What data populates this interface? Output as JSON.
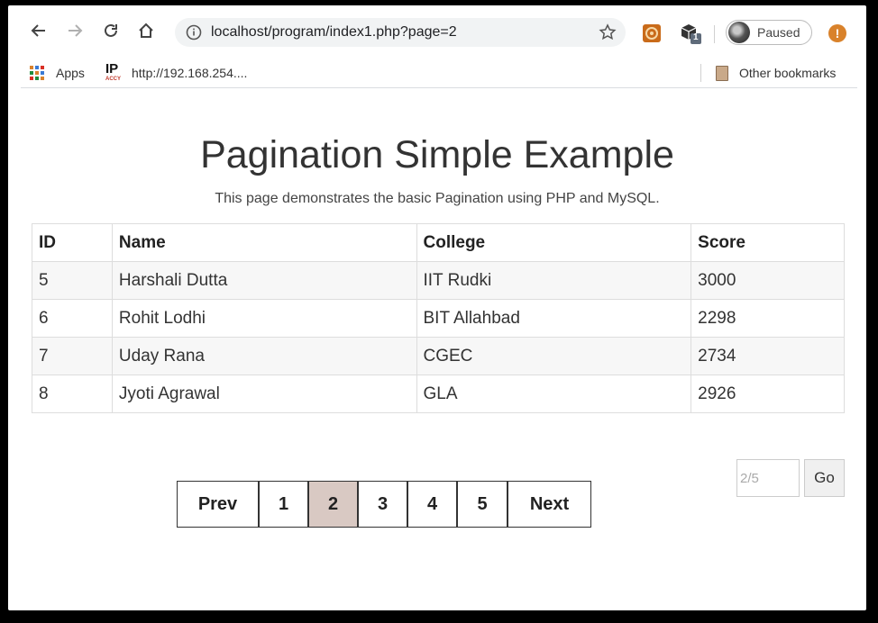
{
  "browser": {
    "url": "localhost/program/index1.php?page=2",
    "profile_status": "Paused",
    "extension_badge": "1",
    "bookmarks": [
      {
        "label": "Apps"
      },
      {
        "label": "http://192.168.254....",
        "icon_text": "IP",
        "icon_subtext": "ACCY"
      }
    ],
    "other_bookmarks": "Other bookmarks",
    "menu_glyph": "!"
  },
  "page": {
    "title": "Pagination Simple Example",
    "subtitle": "This page demonstrates the basic Pagination using PHP and MySQL."
  },
  "table": {
    "columns": [
      "ID",
      "Name",
      "College",
      "Score"
    ],
    "rows": [
      [
        "5",
        "Harshali Dutta",
        "IIT Rudki",
        "3000"
      ],
      [
        "6",
        "Rohit Lodhi",
        "BIT Allahbad",
        "2298"
      ],
      [
        "7",
        "Uday Rana",
        "CGEC",
        "2734"
      ],
      [
        "8",
        "Jyoti Agrawal",
        "GLA",
        "2926"
      ]
    ]
  },
  "pagination": {
    "prev_label": "Prev",
    "pages": [
      "1",
      "2",
      "3",
      "4",
      "5"
    ],
    "current_page": "2",
    "next_label": "Next"
  },
  "goto": {
    "placeholder": "2/5",
    "button_label": "Go"
  },
  "colors": {
    "active_page_bg": "#d9c9c3",
    "menu_accent": "#d9822b"
  }
}
